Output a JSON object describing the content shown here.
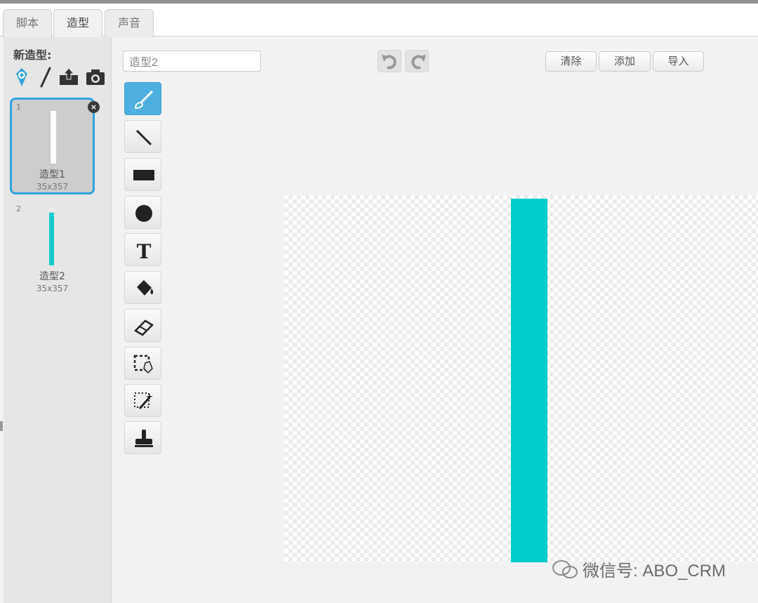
{
  "tabs": [
    {
      "label": "脚本"
    },
    {
      "label": "造型"
    },
    {
      "label": "声音"
    }
  ],
  "active_tab": "造型",
  "sidebar": {
    "new_costume_label": "新造型:",
    "new_icons": [
      "sprite-library-icon",
      "paint-brush-icon",
      "upload-icon",
      "camera-icon"
    ],
    "costumes": [
      {
        "index": "1",
        "name": "造型1",
        "size": "35x357",
        "bar_color": "#ffffff"
      },
      {
        "index": "2",
        "name": "造型2",
        "size": "35x357",
        "bar_color": "#17c9c9"
      }
    ]
  },
  "editor": {
    "costume_name": "造型2",
    "buttons": {
      "clear": "清除",
      "add": "添加",
      "import": "导入"
    },
    "tools": [
      "brush-tool",
      "line-tool",
      "rectangle-tool",
      "ellipse-tool",
      "text-tool",
      "fill-tool",
      "eraser-tool",
      "select-tool",
      "magic-select-tool",
      "stamp-tool"
    ],
    "canvas_shape_color": "#00cccc"
  },
  "watermark": "微信号: ABO_CRM"
}
